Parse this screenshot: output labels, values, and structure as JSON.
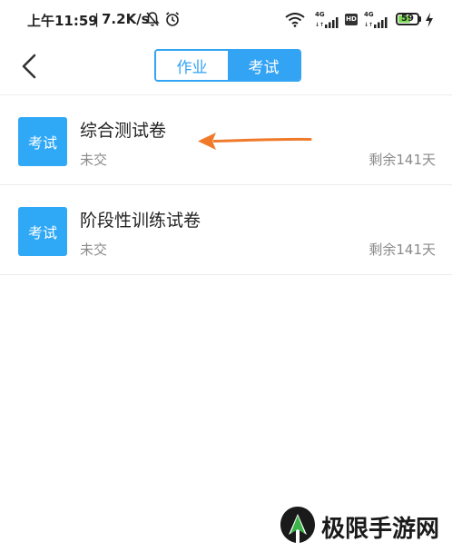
{
  "status_bar": {
    "time": "上午11:59",
    "separator": "|",
    "net_speed": "7.2K/s",
    "signal_label_1": "4G",
    "signal_label_2": "4G",
    "hd_label": "HD",
    "battery_level": "59",
    "icons": [
      "mute-bell-icon",
      "alarm-clock-icon",
      "wifi-icon",
      "signal-icon",
      "hd-icon",
      "battery-icon",
      "charging-icon"
    ]
  },
  "header": {
    "back_icon": "chevron-left-icon",
    "tabs": [
      {
        "label": "作业",
        "active": false
      },
      {
        "label": "考试",
        "active": true
      }
    ]
  },
  "exams": [
    {
      "badge": "考试",
      "title": "综合测试卷",
      "status": "未交",
      "remaining": "剩余141天"
    },
    {
      "badge": "考试",
      "title": "阶段性训练试卷",
      "status": "未交",
      "remaining": "剩余141天"
    }
  ],
  "annotation": {
    "arrow_color": "#f07a2a"
  },
  "watermark": {
    "text": "极限手游网",
    "logo_colors": [
      "#1a1a1a",
      "#3bb44a"
    ]
  },
  "colors": {
    "accent": "#33a3f4",
    "badge": "#2fa8f6",
    "muted_text": "#8a8a8a"
  }
}
